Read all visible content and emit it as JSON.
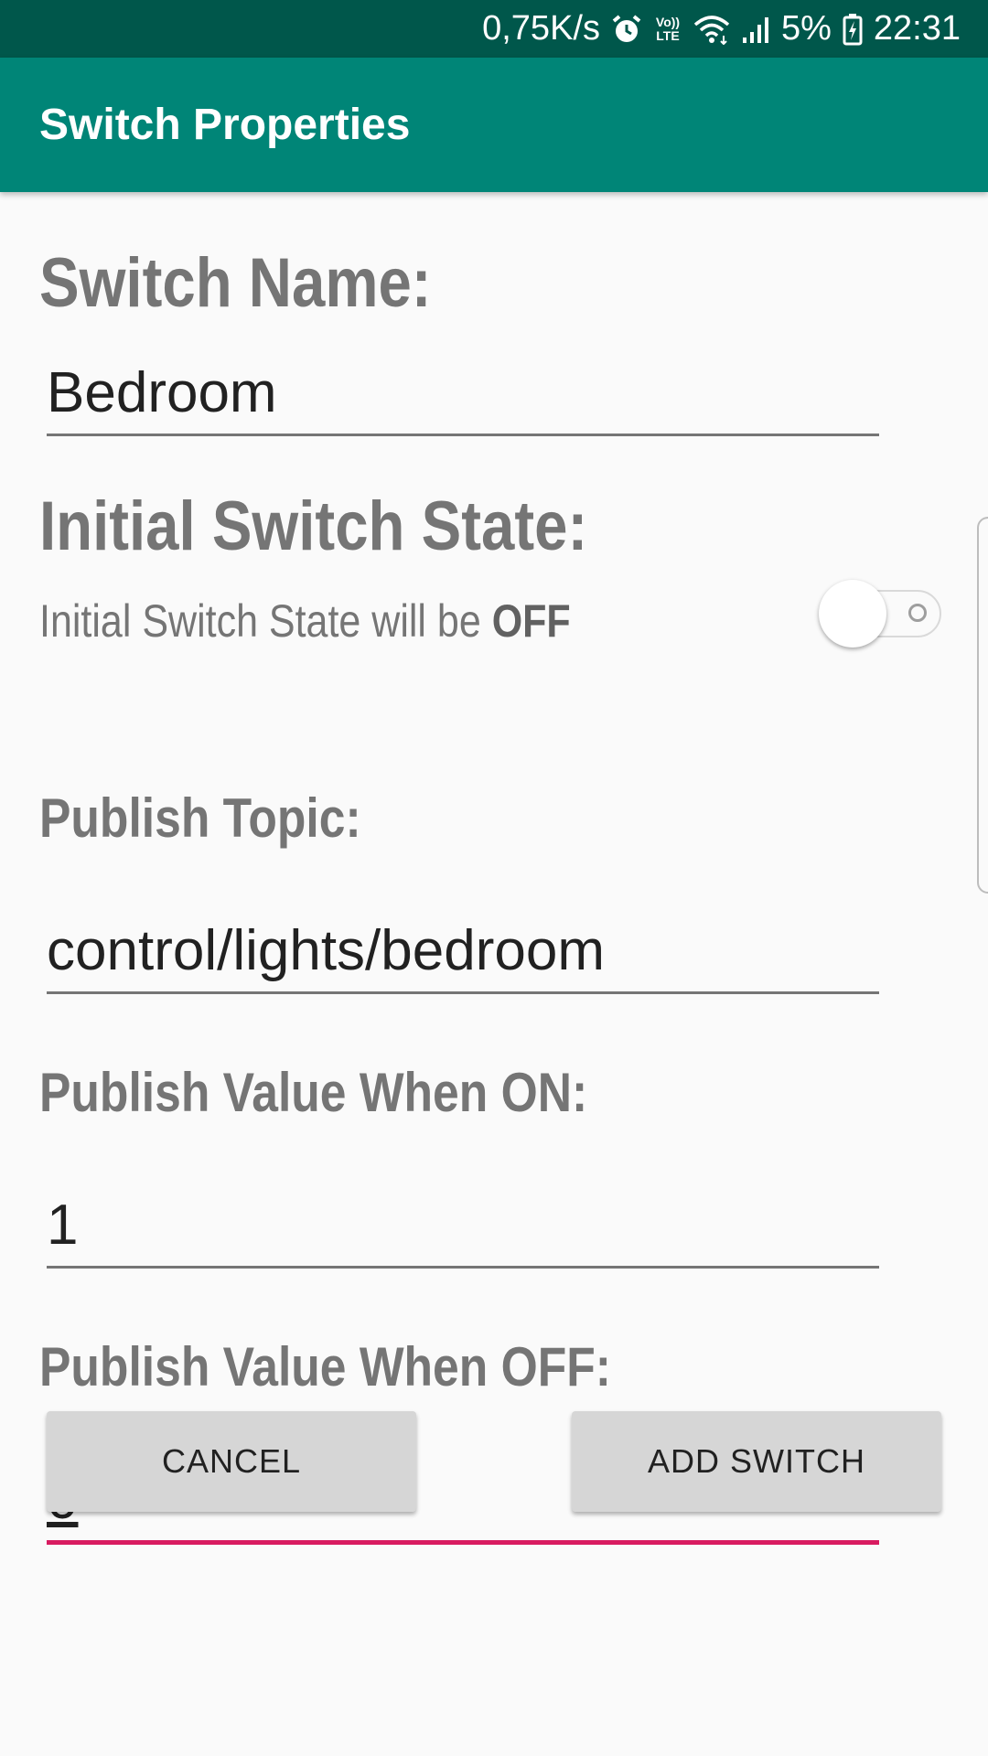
{
  "status_bar": {
    "network_speed": "0,75K/s",
    "volte_label": "Vo)) LTE",
    "battery_percent": "5%",
    "time": "22:31",
    "icons": [
      "alarm-icon",
      "volte-icon",
      "wifi-icon",
      "signal-icon",
      "battery-charging-icon"
    ]
  },
  "app_bar": {
    "title": "Switch Properties"
  },
  "form": {
    "switch_name_label": "Switch Name:",
    "switch_name_value": "Bedroom",
    "initial_state_label": "Initial Switch State:",
    "initial_state_text": "Initial Switch State will be ",
    "initial_state_value": "OFF",
    "initial_state_on": false,
    "publish_topic_label": "Publish Topic:",
    "publish_topic_value": "control/lights/bedroom",
    "value_on_label": "Publish Value When ON:",
    "value_on_value": "1",
    "value_off_label": "Publish Value When OFF:",
    "value_off_value": "0"
  },
  "buttons": {
    "cancel_label": "CANCEL",
    "add_label": "ADD SWITCH"
  },
  "colors": {
    "status_bar": "#00574b",
    "app_bar": "#008577",
    "accent": "#d81b60",
    "label_grey": "#757575"
  }
}
